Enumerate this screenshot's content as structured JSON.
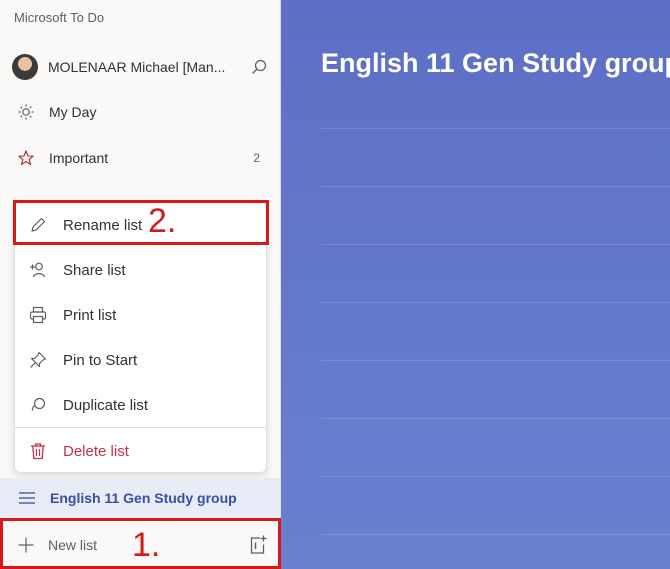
{
  "app": {
    "title": "Microsoft To Do"
  },
  "profile": {
    "name": "MOLENAAR Michael [Man..."
  },
  "nav": [
    {
      "label": "My Day",
      "icon": "sun-icon"
    },
    {
      "label": "Important",
      "icon": "star-icon",
      "count": "2"
    }
  ],
  "context_menu": [
    {
      "label": "Rename list",
      "icon": "pencil-icon"
    },
    {
      "label": "Share list",
      "icon": "share-person-icon"
    },
    {
      "label": "Print list",
      "icon": "printer-icon"
    },
    {
      "label": "Pin to Start",
      "icon": "pin-icon"
    },
    {
      "label": "Duplicate list",
      "icon": "duplicate-icon"
    },
    {
      "label": "Delete list",
      "icon": "trash-icon"
    }
  ],
  "active_list": {
    "label": "English 11 Gen Study group",
    "icon": "list-lines-icon"
  },
  "new_list": {
    "label": "New list",
    "icon": "plus-icon",
    "group_icon": "new-group-icon"
  },
  "main": {
    "title": "English 11 Gen Study group"
  },
  "callouts": [
    {
      "label": "2."
    },
    {
      "label": "1."
    }
  ],
  "colors": {
    "accent": "#3a4ea8",
    "main_bg": "#6479cb",
    "callout": "#d7191c",
    "delete": "#c4314b"
  }
}
